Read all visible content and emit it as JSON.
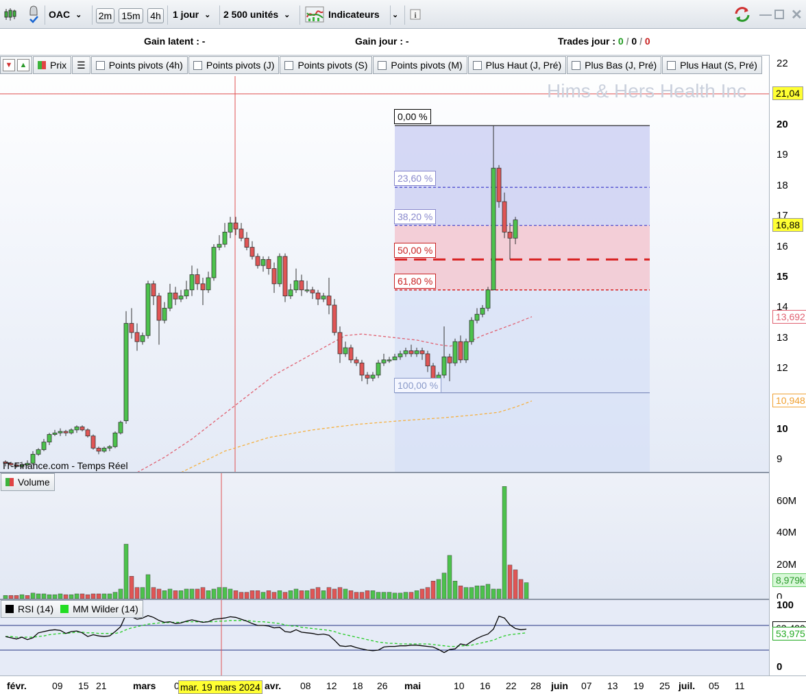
{
  "toolbar": {
    "symbol": "OAC",
    "intervals": [
      "2m",
      "15m",
      "4h"
    ],
    "period": "1 jour",
    "units": "2 500 unités",
    "indicators_label": "Indicateurs"
  },
  "gain_bar": {
    "latent_label": "Gain latent :",
    "latent_value": "-",
    "day_label": "Gain jour :",
    "day_value": "-",
    "trades_label": "Trades jour :",
    "trades_values": [
      "0",
      "0",
      "0"
    ],
    "trades_sep": "/"
  },
  "legend": {
    "price": "Prix",
    "items": [
      "Points pivots (4h)",
      "Points pivots (J)",
      "Points pivots (S)",
      "Points pivots (M)",
      "Plus Haut (J, Pré)",
      "Plus Bas (J, Pré)",
      "Plus Haut (S, Pré)"
    ]
  },
  "chart": {
    "watermark": "Hims & Hers Health Inc",
    "source": "IT-Finance.com - Temps Réel",
    "last_price": "16,88",
    "ref_line_price": "21,04",
    "ma_red_value": "13,692",
    "ma_orange_value": "10,948",
    "fib_levels": [
      {
        "label": "0,00 %",
        "price": 20.0
      },
      {
        "label": "23,60 %",
        "price": 17.97
      },
      {
        "label": "38,20 %",
        "price": 16.72
      },
      {
        "label": "50,00 %",
        "price": 15.6
      },
      {
        "label": "61,80 %",
        "price": 14.6
      },
      {
        "label": "100,00 %",
        "price": 11.22
      }
    ],
    "y_ticks": [
      "22",
      "20",
      "19",
      "18",
      "17",
      "16",
      "15",
      "14",
      "13",
      "12",
      "10",
      "9"
    ],
    "cursor_date": "mar. 19 mars 2024"
  },
  "chart_data": {
    "type": "candlestick",
    "price_ylim": [
      8.6,
      22.3
    ],
    "candles": [
      [
        8.95,
        8.9,
        9.0,
        8.8
      ],
      [
        8.9,
        8.85,
        8.95,
        8.8
      ],
      [
        8.85,
        8.8,
        8.9,
        8.75
      ],
      [
        8.8,
        8.85,
        8.95,
        8.75
      ],
      [
        8.85,
        8.9,
        9.0,
        8.8
      ],
      [
        8.9,
        9.2,
        9.3,
        8.85
      ],
      [
        9.2,
        9.35,
        9.4,
        9.15
      ],
      [
        9.35,
        9.6,
        9.7,
        9.3
      ],
      [
        9.6,
        9.85,
        9.9,
        9.5
      ],
      [
        9.85,
        9.9,
        10.0,
        9.8
      ],
      [
        9.9,
        9.95,
        10.05,
        9.8
      ],
      [
        9.95,
        9.9,
        10.0,
        9.8
      ],
      [
        9.9,
        10.0,
        10.05,
        9.85
      ],
      [
        10.0,
        10.1,
        10.15,
        9.9
      ],
      [
        10.1,
        10.0,
        10.15,
        9.95
      ],
      [
        10.0,
        9.8,
        10.05,
        9.75
      ],
      [
        9.8,
        9.4,
        9.85,
        9.35
      ],
      [
        9.4,
        9.3,
        9.45,
        9.2
      ],
      [
        9.3,
        9.4,
        9.45,
        9.25
      ],
      [
        9.4,
        9.45,
        9.5,
        9.3
      ],
      [
        9.45,
        9.9,
        9.95,
        9.4
      ],
      [
        9.9,
        10.25,
        10.3,
        9.85
      ],
      [
        10.3,
        13.5,
        13.9,
        10.2
      ],
      [
        13.5,
        13.2,
        14.0,
        13.0
      ],
      [
        13.2,
        12.9,
        13.5,
        12.6
      ],
      [
        12.9,
        13.1,
        13.2,
        12.8
      ],
      [
        13.1,
        14.8,
        14.9,
        13.0
      ],
      [
        14.8,
        14.4,
        14.9,
        14.1
      ],
      [
        14.4,
        13.6,
        14.5,
        12.8
      ],
      [
        13.6,
        14.0,
        14.2,
        13.5
      ],
      [
        14.0,
        14.5,
        14.8,
        13.9
      ],
      [
        14.5,
        14.3,
        14.7,
        14.1
      ],
      [
        14.3,
        14.4,
        14.6,
        14.2
      ],
      [
        14.4,
        14.6,
        14.9,
        14.3
      ],
      [
        14.6,
        15.1,
        15.4,
        14.4
      ],
      [
        15.1,
        14.8,
        15.3,
        14.6
      ],
      [
        14.8,
        14.6,
        15.0,
        14.1
      ],
      [
        14.6,
        15.0,
        15.2,
        14.5
      ],
      [
        15.0,
        16.0,
        16.1,
        14.9
      ],
      [
        16.0,
        16.1,
        16.4,
        15.9
      ],
      [
        16.1,
        16.5,
        16.8,
        16.0
      ],
      [
        16.5,
        16.8,
        17.0,
        16.3
      ],
      [
        16.8,
        16.6,
        17.0,
        16.4
      ],
      [
        16.6,
        16.3,
        16.8,
        16.2
      ],
      [
        16.3,
        16.0,
        16.5,
        15.9
      ],
      [
        16.0,
        15.7,
        16.2,
        15.6
      ],
      [
        15.7,
        15.4,
        15.8,
        15.3
      ],
      [
        15.4,
        15.6,
        15.7,
        15.2
      ],
      [
        15.6,
        15.3,
        15.7,
        15.1
      ],
      [
        15.3,
        14.8,
        15.5,
        14.5
      ],
      [
        14.8,
        15.7,
        15.8,
        14.7
      ],
      [
        15.7,
        14.4,
        15.8,
        14.2
      ],
      [
        14.4,
        14.6,
        14.8,
        14.3
      ],
      [
        14.6,
        14.9,
        15.3,
        14.5
      ],
      [
        14.9,
        14.6,
        15.1,
        14.4
      ],
      [
        14.6,
        14.6,
        14.9,
        14.5
      ],
      [
        14.6,
        14.5,
        14.7,
        14.3
      ],
      [
        14.5,
        14.3,
        14.6,
        14.1
      ],
      [
        14.3,
        14.4,
        14.5,
        14.2
      ],
      [
        14.4,
        14.1,
        15.0,
        13.8
      ],
      [
        14.1,
        13.2,
        14.3,
        13.1
      ],
      [
        13.2,
        12.5,
        13.4,
        12.2
      ],
      [
        12.5,
        12.7,
        12.9,
        12.4
      ],
      [
        12.7,
        12.3,
        12.8,
        12.2
      ],
      [
        12.3,
        12.2,
        12.4,
        12.1
      ],
      [
        12.2,
        11.8,
        12.3,
        11.6
      ],
      [
        11.8,
        11.7,
        11.9,
        11.5
      ],
      [
        11.7,
        11.8,
        11.9,
        11.6
      ],
      [
        11.8,
        12.2,
        12.3,
        11.7
      ],
      [
        12.2,
        12.3,
        12.5,
        12.1
      ],
      [
        12.3,
        12.3,
        12.4,
        12.2
      ],
      [
        12.3,
        12.4,
        12.5,
        12.3
      ],
      [
        12.4,
        12.5,
        12.6,
        12.3
      ],
      [
        12.5,
        12.6,
        12.7,
        12.4
      ],
      [
        12.6,
        12.5,
        12.8,
        12.4
      ],
      [
        12.5,
        12.6,
        12.7,
        12.4
      ],
      [
        12.6,
        12.5,
        12.7,
        12.3
      ],
      [
        12.5,
        12.1,
        12.6,
        11.9
      ],
      [
        12.1,
        11.7,
        12.2,
        11.3
      ],
      [
        11.7,
        11.8,
        11.9,
        11.6
      ],
      [
        11.8,
        12.4,
        13.4,
        11.7
      ],
      [
        12.4,
        12.2,
        12.5,
        11.6
      ],
      [
        12.2,
        12.9,
        13.0,
        12.1
      ],
      [
        12.9,
        12.3,
        13.1,
        12.2
      ],
      [
        12.3,
        12.9,
        13.0,
        12.2
      ],
      [
        12.9,
        13.6,
        13.7,
        12.8
      ],
      [
        13.6,
        13.8,
        14.0,
        13.5
      ],
      [
        13.8,
        14.0,
        14.1,
        13.7
      ],
      [
        14.0,
        14.6,
        14.7,
        13.9
      ],
      [
        14.6,
        18.6,
        20.0,
        15.9
      ],
      [
        18.6,
        17.5,
        18.7,
        17.3
      ],
      [
        17.5,
        16.5,
        17.8,
        16.3
      ],
      [
        16.5,
        16.3,
        16.8,
        15.6
      ],
      [
        16.3,
        16.9,
        17.0,
        16.1
      ]
    ],
    "ma_red": [
      [
        24,
        8.6
      ],
      [
        29,
        9.1
      ],
      [
        34,
        9.7
      ],
      [
        39,
        10.4
      ],
      [
        44,
        11.1
      ],
      [
        49,
        11.8
      ],
      [
        54,
        12.3
      ],
      [
        59,
        12.8
      ],
      [
        62,
        13.1
      ],
      [
        65,
        13.15
      ],
      [
        70,
        13.05
      ],
      [
        75,
        12.95
      ],
      [
        79,
        12.8
      ],
      [
        81,
        12.75
      ],
      [
        84,
        12.85
      ],
      [
        87,
        13.1
      ],
      [
        90,
        13.3
      ],
      [
        93,
        13.5
      ],
      [
        96,
        13.72
      ]
    ],
    "ma_orange": [
      [
        32,
        8.6
      ],
      [
        40,
        9.3
      ],
      [
        48,
        9.75
      ],
      [
        56,
        10.0
      ],
      [
        64,
        10.18
      ],
      [
        72,
        10.3
      ],
      [
        80,
        10.4
      ],
      [
        86,
        10.5
      ],
      [
        90,
        10.58
      ],
      [
        93,
        10.75
      ],
      [
        96,
        10.95
      ]
    ],
    "volume_ylim": [
      0,
      74
    ],
    "volume_ticks": [
      "60M",
      "40M",
      "20M",
      "0"
    ],
    "volume_last": "8,979k",
    "volumes": [
      2,
      2,
      2,
      2.5,
      2,
      3.5,
      3,
      3,
      2.5,
      2.5,
      3,
      2.5,
      2.5,
      3,
      3,
      2.5,
      3,
      3,
      3,
      3,
      4,
      6,
      34,
      14,
      7,
      7,
      15,
      7,
      6,
      5,
      6,
      5,
      5,
      6,
      6,
      6,
      7,
      5,
      6,
      7,
      7,
      6,
      5,
      4,
      4,
      5,
      5,
      4,
      5,
      4,
      5,
      4,
      5,
      6,
      5,
      5,
      6,
      7,
      5,
      7,
      6,
      7,
      6,
      5,
      4,
      4,
      5,
      5,
      4,
      4,
      4,
      3.5,
      3.5,
      4,
      4,
      5,
      6,
      7,
      11,
      12,
      16,
      27,
      11,
      8,
      7,
      7,
      8,
      8,
      9,
      6,
      6,
      70,
      21,
      18,
      12,
      10
    ],
    "volume_up": [
      1,
      0,
      0,
      1,
      0,
      1,
      1,
      1,
      1,
      1,
      1,
      0,
      1,
      1,
      0,
      0,
      0,
      0,
      1,
      1,
      1,
      1,
      1,
      0,
      0,
      1,
      1,
      0,
      0,
      1,
      1,
      0,
      1,
      1,
      1,
      0,
      0,
      1,
      1,
      1,
      1,
      1,
      0,
      0,
      0,
      0,
      0,
      1,
      0,
      0,
      1,
      0,
      1,
      1,
      0,
      1,
      0,
      0,
      1,
      0,
      0,
      0,
      1,
      0,
      0,
      0,
      0,
      1,
      1,
      1,
      1,
      1,
      1,
      1,
      0,
      1,
      0,
      0,
      0,
      1,
      1,
      1,
      1,
      0,
      1,
      1,
      1,
      1,
      1,
      1,
      1,
      1,
      0,
      0,
      0,
      1
    ],
    "rsi_ylim": [
      0,
      100
    ],
    "rsi_ticks": [
      "100",
      "0"
    ],
    "rsi_levels": [
      70,
      30
    ],
    "rsi_value": "63,490",
    "wilder_value": "53,975",
    "rsi_legend": [
      "RSI (14)",
      "MM Wilder (14)"
    ],
    "rsi": [
      52,
      50,
      48,
      51,
      47,
      50,
      58,
      60,
      62,
      63,
      62,
      57,
      60,
      61,
      58,
      52,
      55,
      53,
      52,
      53,
      60,
      68,
      88,
      84,
      80,
      82,
      86,
      83,
      78,
      75,
      76,
      73,
      74,
      77,
      79,
      77,
      75,
      76,
      80,
      81,
      82,
      84,
      83,
      80,
      77,
      73,
      70,
      70,
      69,
      66,
      67,
      60,
      59,
      63,
      59,
      58,
      57,
      55,
      56,
      54,
      46,
      37,
      36,
      37,
      34,
      32,
      30,
      29,
      30,
      35,
      36,
      36,
      37,
      37,
      38,
      38,
      37,
      36,
      35,
      31,
      26,
      31,
      32,
      40,
      38,
      44,
      49,
      53,
      56,
      64,
      85,
      82,
      71,
      65,
      63,
      64
    ],
    "wilder": [
      52,
      52,
      51,
      51,
      51,
      51,
      52,
      53,
      55,
      56,
      57,
      57,
      58,
      59,
      59,
      58,
      58,
      57,
      57,
      57,
      57,
      59,
      63,
      66,
      68,
      70,
      72,
      73,
      74,
      74,
      75,
      75,
      75,
      76,
      76,
      76,
      76,
      76,
      76,
      77,
      77,
      78,
      78,
      78,
      78,
      77,
      76,
      76,
      75,
      74,
      73,
      71,
      69,
      69,
      67,
      66,
      65,
      64,
      63,
      62,
      60,
      57,
      55,
      53,
      51,
      49,
      47,
      45,
      43,
      42,
      41,
      41,
      40,
      40,
      40,
      40,
      40,
      40,
      39,
      38,
      37,
      36,
      36,
      37,
      37,
      38,
      40,
      42,
      44,
      46,
      50,
      53,
      55,
      56,
      57,
      58
    ],
    "x_labels": [
      "févr.",
      "09",
      "15",
      "21",
      "mars",
      "0",
      "avr.",
      "08",
      "12",
      "18",
      "26",
      "mai",
      "10",
      "16",
      "22",
      "28",
      "juin",
      "07",
      "13",
      "19",
      "25",
      "juil.",
      "05",
      "11"
    ]
  }
}
